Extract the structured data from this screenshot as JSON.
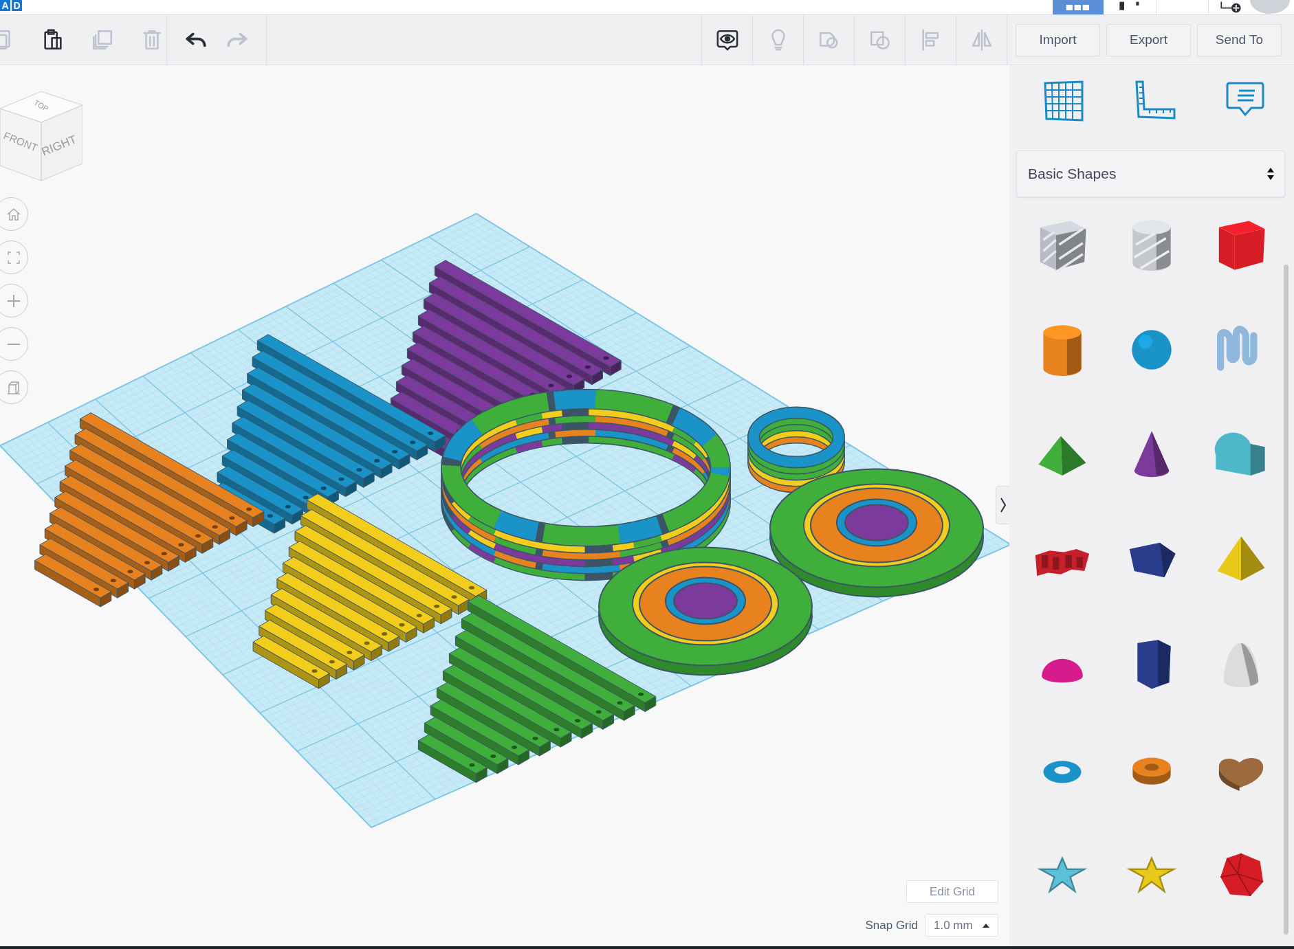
{
  "logo": {
    "letters": [
      "A",
      "D"
    ]
  },
  "toolbar": {
    "edit_tools": [
      {
        "kind": "copy",
        "disabled": true
      },
      {
        "kind": "paste",
        "disabled": false
      },
      {
        "kind": "duplicate",
        "disabled": true
      },
      {
        "kind": "delete",
        "disabled": true
      }
    ],
    "history_tools": [
      {
        "kind": "undo",
        "disabled": false
      },
      {
        "kind": "redo",
        "disabled": true
      }
    ],
    "view_tools": [
      {
        "kind": "notes-toggle",
        "disabled": false
      },
      {
        "kind": "light",
        "disabled": true
      },
      {
        "kind": "group",
        "disabled": true
      },
      {
        "kind": "ungroup",
        "disabled": true
      },
      {
        "kind": "align",
        "disabled": true
      },
      {
        "kind": "mirror",
        "disabled": true
      }
    ],
    "buttons": [
      "Import",
      "Export",
      "Send To"
    ]
  },
  "view_cube": {
    "top": "TOP",
    "front": "FRONT",
    "right": "RIGHT"
  },
  "view_controls": [
    {
      "kind": "home"
    },
    {
      "kind": "fit"
    },
    {
      "kind": "zoom-in"
    },
    {
      "kind": "zoom-out"
    },
    {
      "kind": "perspective"
    }
  ],
  "grid_controls": {
    "edit_button": "Edit Grid",
    "snap_label": "Snap Grid",
    "snap_value": "1.0 mm"
  },
  "panel": {
    "tabs": [
      {
        "kind": "workplane"
      },
      {
        "kind": "ruler"
      },
      {
        "kind": "notes"
      }
    ],
    "library": "Basic Shapes",
    "shapes": [
      {
        "kind": "box-hole",
        "color": "#b8bcc4"
      },
      {
        "kind": "cylinder-hole",
        "color": "#c4c8ce"
      },
      {
        "kind": "box",
        "color": "#d61d26"
      },
      {
        "kind": "cylinder",
        "color": "#e8821e"
      },
      {
        "kind": "sphere",
        "color": "#1a93c8"
      },
      {
        "kind": "scribble",
        "color": "#8fb8dc"
      },
      {
        "kind": "roof",
        "color": "#3fae3a"
      },
      {
        "kind": "cone",
        "color": "#7b3a9c"
      },
      {
        "kind": "round-roof",
        "color": "#4fb8c8"
      },
      {
        "kind": "text",
        "color": "#c8202a"
      },
      {
        "kind": "wedge",
        "color": "#2a3c8c"
      },
      {
        "kind": "pyramid",
        "color": "#e8c81a"
      },
      {
        "kind": "half-sphere",
        "color": "#d61c8c"
      },
      {
        "kind": "polygon",
        "color": "#2a3c8c"
      },
      {
        "kind": "paraboloid",
        "color": "#dcdcdc"
      },
      {
        "kind": "torus",
        "color": "#1a93c8"
      },
      {
        "kind": "tube",
        "color": "#e8821e"
      },
      {
        "kind": "heart",
        "color": "#9c6a3c"
      },
      {
        "kind": "star",
        "color": "#5cc0d8"
      },
      {
        "kind": "star",
        "color": "#e8c81a"
      },
      {
        "kind": "icosahedron",
        "color": "#d61d26"
      }
    ]
  }
}
